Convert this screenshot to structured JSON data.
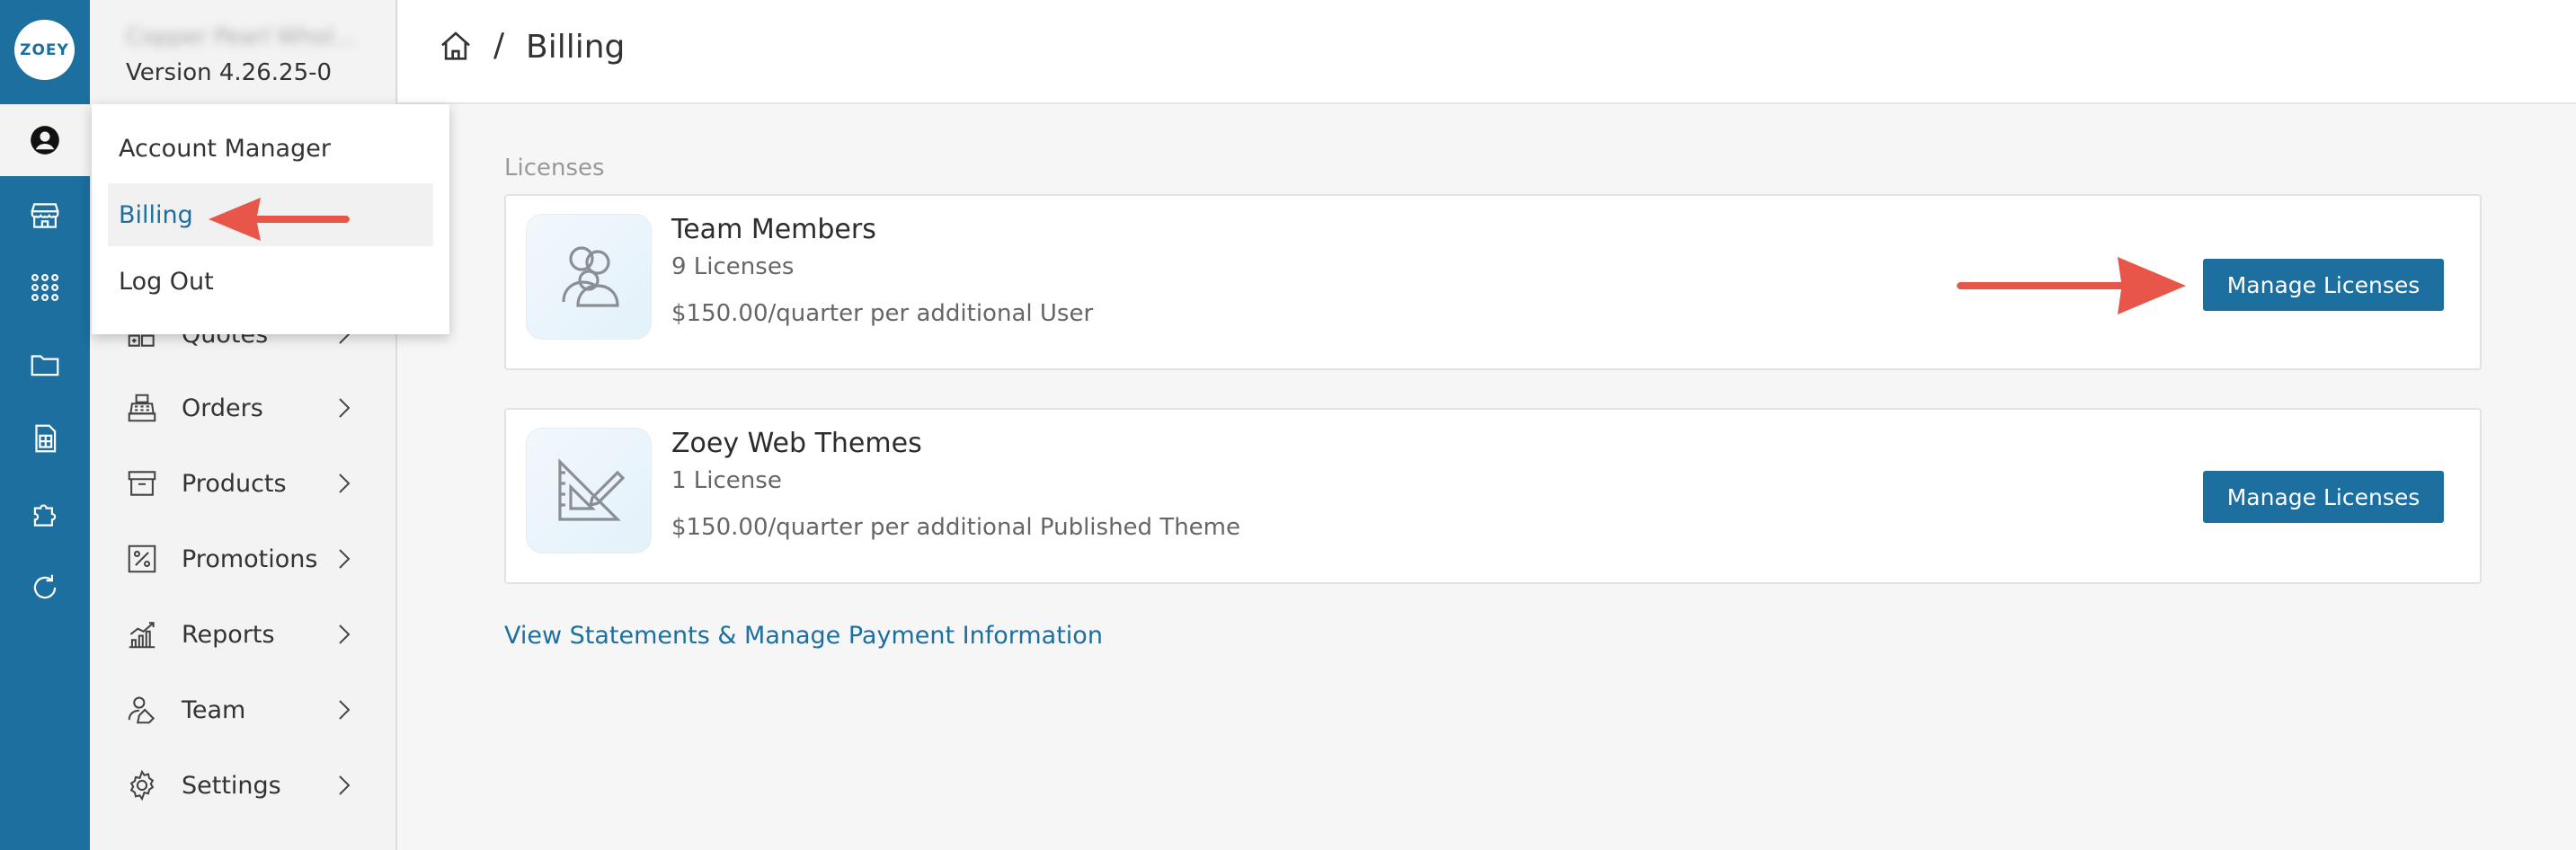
{
  "app": {
    "logo_text": "ZOEY",
    "store_name": "Copper Pearl Whol...",
    "version": "Version 4.26.25-0"
  },
  "rail": {
    "icons": [
      "user-circle-icon",
      "storefront-icon",
      "apps-grid-icon",
      "folder-icon",
      "spreadsheet-icon",
      "puzzle-icon",
      "refresh-icon"
    ]
  },
  "sidebar": {
    "items": [
      {
        "label": "Quotes",
        "icon": "quotes-icon"
      },
      {
        "label": "Orders",
        "icon": "cash-register-icon"
      },
      {
        "label": "Products",
        "icon": "box-icon"
      },
      {
        "label": "Promotions",
        "icon": "percent-icon"
      },
      {
        "label": "Reports",
        "icon": "bar-chart-icon"
      },
      {
        "label": "Team",
        "icon": "team-icon"
      },
      {
        "label": "Settings",
        "icon": "gear-icon"
      }
    ]
  },
  "account_menu": {
    "items": [
      {
        "label": "Account Manager",
        "active": false
      },
      {
        "label": "Billing",
        "active": true
      },
      {
        "label": "Log Out",
        "active": false
      }
    ]
  },
  "breadcrumb": {
    "home_icon": "home-icon",
    "separator": "/",
    "current": "Billing"
  },
  "licenses": {
    "section_label": "Licenses",
    "cards": [
      {
        "title": "Team Members",
        "count": "9 Licenses",
        "price": "$150.00/quarter per additional User",
        "icon": "team-members-icon",
        "button_label": "Manage Licenses"
      },
      {
        "title": "Zoey Web Themes",
        "count": "1 License",
        "price": "$150.00/quarter per additional Published Theme",
        "icon": "set-square-icon",
        "button_label": "Manage Licenses"
      }
    ],
    "statements_link": "View Statements & Manage Payment Information"
  },
  "colors": {
    "brand": "#1c6f9f",
    "annotation_arrow": "#e8564a",
    "sidebar_bg": "#f3f3f3",
    "content_bg": "#f6f6f6"
  }
}
